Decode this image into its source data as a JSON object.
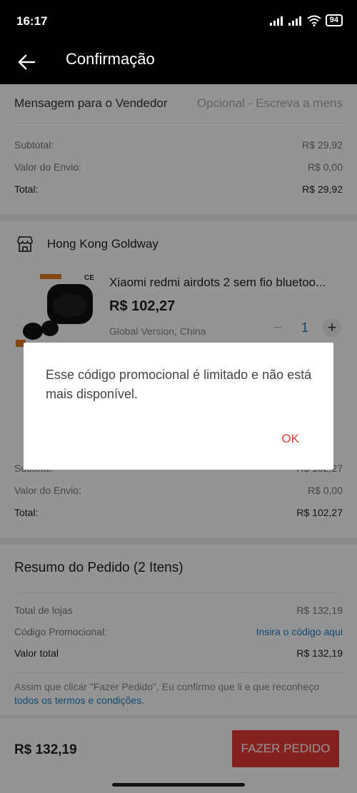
{
  "status_bar": {
    "time": "16:17",
    "battery": "94"
  },
  "app_bar": {
    "title": "Confirmação"
  },
  "first_store": {
    "message_label": "Mensagem para o Vendedor",
    "message_placeholder": "Opcional - Escreva a mens",
    "subtotal_label": "Subtotal:",
    "subtotal_value": "R$ 29,92",
    "shipping_label": "Valor do Envio:",
    "shipping_value": "R$ 0,00",
    "total_label": "Total:",
    "total_value": "R$ 29,92"
  },
  "second_store": {
    "store_name": "Hong Kong Goldway",
    "product": {
      "name": "Xiaomi redmi airdots 2 sem fio bluetoo...",
      "price": "R$ 102,27",
      "variant": "Global Version, China",
      "quantity": "1",
      "minus": "−",
      "plus": "+"
    },
    "subtotal_label": "Subtotal:",
    "subtotal_value": "R$ 102,27",
    "shipping_label": "Valor do Envio:",
    "shipping_value": "R$ 0,00",
    "total_label": "Total:",
    "total_value": "R$ 102,27"
  },
  "summary": {
    "title": "Resumo do Pedido (2 Itens)",
    "stores_total_label": "Total de lojas",
    "stores_total_value": "R$ 132,19",
    "promo_label": "Código Promocional:",
    "promo_link": "Insira o código aqui",
    "grand_total_label": "Valor total",
    "grand_total_value": "R$ 132,19"
  },
  "terms": {
    "text": "Assim que clicar \"Fazer Pedido\", Eu confirmo que li e que reconheço ",
    "link": "todos os termos e condições."
  },
  "bottom_bar": {
    "total": "R$ 132,19",
    "button": "FAZER PEDIDO"
  },
  "dialog": {
    "message": "Esse código promocional é limitado e não está mais disponível.",
    "ok": "OK"
  },
  "colors": {
    "accent": "#e53935",
    "link": "#1d7fc2"
  }
}
